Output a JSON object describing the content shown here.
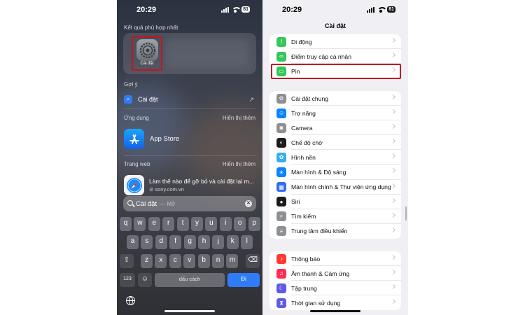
{
  "left": {
    "time": "20:29",
    "battery": "81",
    "top_hit_label": "Kết quả phù hợp nhất",
    "top_hit_app": "Cài đặt",
    "suggestion_label": "Gợi ý",
    "suggestion_text": "Cài đặt",
    "apps_label": "Ứng dụng",
    "show_more": "Hiển thị thêm",
    "app_result": "App Store",
    "web_label": "Trang web",
    "web_title": "Làm thế nào để gỡ bỏ và cài đặt lại m...",
    "web_url": "sony.com.vn",
    "search_query": "Cài đặt",
    "search_hint": "— Mở",
    "keyboard": {
      "row1": [
        "q",
        "w",
        "e",
        "r",
        "t",
        "y",
        "u",
        "i",
        "o",
        "p"
      ],
      "row2": [
        "a",
        "s",
        "d",
        "f",
        "g",
        "h",
        "j",
        "k",
        "l"
      ],
      "row3": [
        "z",
        "x",
        "c",
        "v",
        "b",
        "n",
        "m"
      ],
      "numbers": "123",
      "space": "dấu cách",
      "go": "Đi"
    }
  },
  "right": {
    "time": "20:29",
    "battery": "81",
    "title": "Cài đặt",
    "group1": [
      {
        "label": "Di động",
        "icon": "antenna-icon",
        "color": "#34c759"
      },
      {
        "label": "Điểm truy cập cá nhân",
        "icon": "link-icon",
        "color": "#34c759"
      },
      {
        "label": "Pin",
        "icon": "battery-icon",
        "color": "#34c759"
      }
    ],
    "group2": [
      {
        "label": "Cài đặt chung",
        "icon": "gear-icon",
        "color": "#8e8e93"
      },
      {
        "label": "Trợ năng",
        "icon": "accessibility-icon",
        "color": "#0a84ff"
      },
      {
        "label": "Camera",
        "icon": "camera-icon",
        "color": "#8e8e93"
      },
      {
        "label": "Chế độ chờ",
        "icon": "standby-icon",
        "color": "#1c1c1e"
      },
      {
        "label": "Hình nền",
        "icon": "wallpaper-icon",
        "color": "#30b0f0"
      },
      {
        "label": "Màn hình & Độ sáng",
        "icon": "sun-icon",
        "color": "#0a84ff"
      },
      {
        "label": "Màn hình chính & Thư viện ứng dụng",
        "icon": "home-screen-icon",
        "color": "#2f6ff0"
      },
      {
        "label": "Siri",
        "icon": "siri-icon",
        "color": "#1c1c1e"
      },
      {
        "label": "Tìm kiếm",
        "icon": "search-icon",
        "color": "#8e8e93"
      },
      {
        "label": "Trung tâm điều khiển",
        "icon": "control-center-icon",
        "color": "#8e8e93"
      }
    ],
    "group3": [
      {
        "label": "Thông báo",
        "icon": "bell-icon",
        "color": "#ff3b30"
      },
      {
        "label": "Âm thanh & Cảm ứng",
        "icon": "speaker-icon",
        "color": "#ff2d55"
      },
      {
        "label": "Tập trung",
        "icon": "moon-icon",
        "color": "#5e5ce6"
      },
      {
        "label": "Thời gian sử dụng",
        "icon": "hourglass-icon",
        "color": "#5e5ce6"
      }
    ]
  }
}
